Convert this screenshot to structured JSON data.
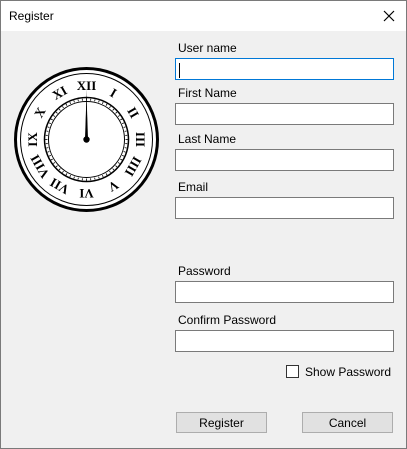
{
  "window": {
    "title": "Register"
  },
  "icons": {
    "close": "close-icon",
    "clock": "clock-icon"
  },
  "clock": {
    "numerals": [
      "XII",
      "I",
      "II",
      "III",
      "IIII",
      "V",
      "VI",
      "VII",
      "VIII",
      "IX",
      "X",
      "XI"
    ],
    "time": "12:00"
  },
  "form": {
    "username_label": "User name",
    "username_value": "",
    "firstname_label": "First Name",
    "firstname_value": "",
    "lastname_label": "Last Name",
    "lastname_value": "",
    "email_label": "Email",
    "email_value": "",
    "password_label": "Password",
    "password_value": "",
    "confirm_label": "Confirm Password",
    "confirm_value": "",
    "show_password_label": "Show Password",
    "show_password_checked": false
  },
  "buttons": {
    "register": "Register",
    "cancel": "Cancel"
  },
  "colors": {
    "focus_border": "#0078d7",
    "dialog_bg": "#f0f0f0"
  }
}
